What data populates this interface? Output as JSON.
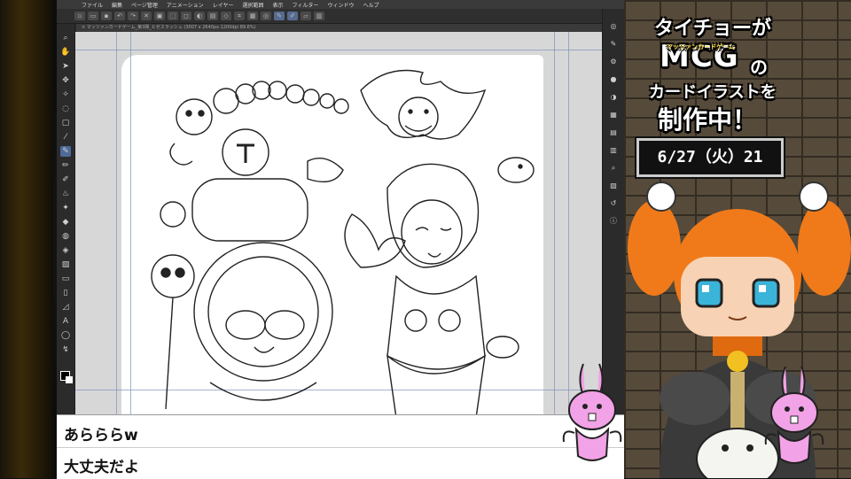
{
  "app": {
    "menu": [
      "ファイル",
      "編集",
      "ページ管理",
      "アニメーション",
      "レイヤー",
      "選択範囲",
      "表示",
      "フィルター",
      "ウィンドウ",
      "ヘルプ"
    ],
    "doc_tab": "× マッツァンカードゲーム_第3弾_ヒゼスラッシュ (3007 x 2640px 1200dpi 89.6%)"
  },
  "chat": {
    "lines": [
      "あらららw",
      "大丈夫だよ"
    ]
  },
  "stream_panel": {
    "title_line1": "タイチョーが",
    "title_mcg": "MCG",
    "title_mcg_sub": "マッツァンカードゲーム",
    "title_no": "の",
    "title_line3": "カードイラストを",
    "title_line4": "制作中！",
    "date": "6/27（火）21"
  },
  "colors": {
    "accent_tool": "#4e6a9a",
    "panel_bg": "#6d5e4a",
    "hair_orange": "#f07a1a",
    "bunny_pink": "#f2a2e6"
  }
}
